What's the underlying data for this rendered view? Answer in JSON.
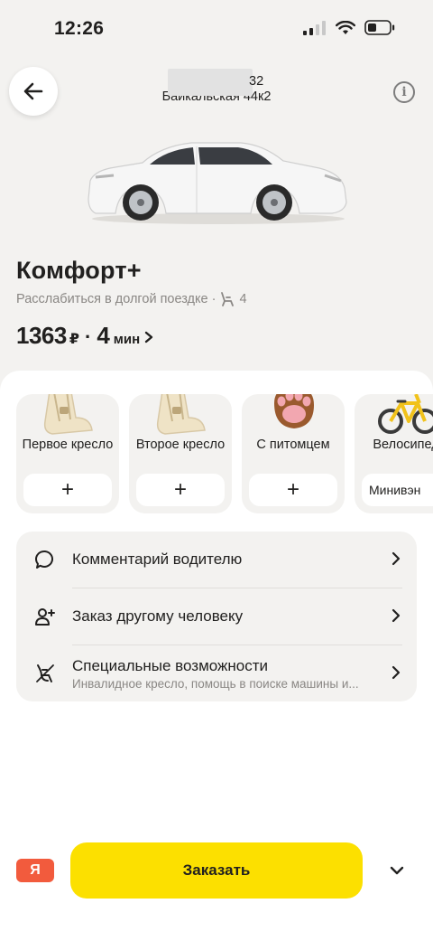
{
  "status_bar": {
    "time": "12:26"
  },
  "header": {
    "address_line1_suffix": "32",
    "address_line2": "Байкальская 44к2"
  },
  "tariff": {
    "title": "Комфорт+",
    "subtitle": "Расслабиться в долгой поездке ·",
    "seats": "4",
    "price": "1363",
    "currency": "₽",
    "time_value": "4",
    "time_unit": "мин"
  },
  "options": [
    {
      "label": "Первое кресло",
      "action": "+"
    },
    {
      "label": "Второе кресло",
      "action": "+"
    },
    {
      "label": "С питомцем",
      "action": "+"
    },
    {
      "label": "Велосипед",
      "action": "Минивэн"
    }
  ],
  "menu": [
    {
      "title": "Комментарий водителю"
    },
    {
      "title": "Заказ другому человеку"
    },
    {
      "title": "Специальные возможности",
      "subtitle": "Инвалидное кресло, помощь в поиске машины и..."
    }
  ],
  "bottom": {
    "payment_badge": "Я",
    "order_label": "Заказать"
  },
  "colors": {
    "accent_yellow": "#fce000",
    "payment_red": "#f25b3d",
    "background": "#f3f2f0"
  }
}
